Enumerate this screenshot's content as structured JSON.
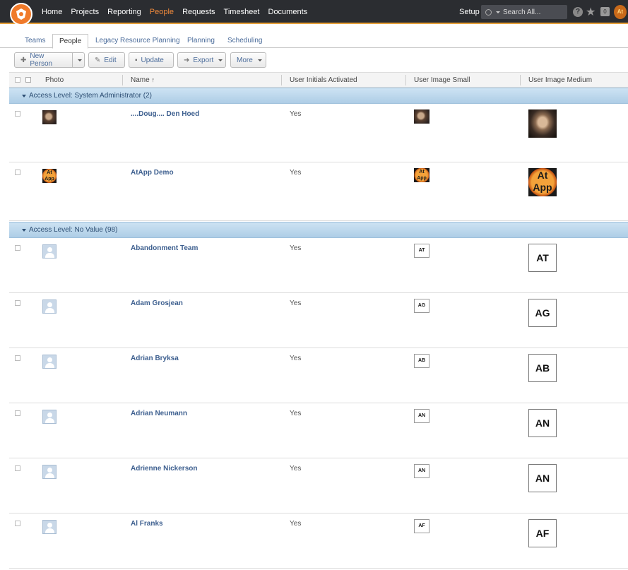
{
  "nav": {
    "items": [
      "Home",
      "Projects",
      "Reporting",
      "People",
      "Requests",
      "Timesheet",
      "Documents"
    ],
    "active": "People",
    "setup": "Setup",
    "search_placeholder": "Search All...",
    "help": "?",
    "notifications": "0",
    "avatar_initials": "At"
  },
  "tabs": [
    "Teams",
    "People",
    "Legacy Resource Planning",
    "Planning",
    "Scheduling"
  ],
  "toolbar": {
    "new_person": "New Person",
    "edit": "Edit",
    "update": "Update",
    "export": "Export",
    "more": "More"
  },
  "columns": {
    "photo": "Photo",
    "name": "Name",
    "initials": "User Initials Activated",
    "small": "User Image Small",
    "medium": "User Image Medium"
  },
  "groups": [
    {
      "label": "Access Level: System Administrator (2)",
      "rows": [
        {
          "name": "....Doug.... Den Hoed",
          "initials_activated": "Yes",
          "image": "photo",
          "initials": ""
        },
        {
          "name": "AtApp Demo",
          "initials_activated": "Yes",
          "image": "atapp-logo",
          "initials": "At App"
        }
      ]
    },
    {
      "label": "Access Level: No Value (98)",
      "rows": [
        {
          "name": "Abandonment Team",
          "initials_activated": "Yes",
          "image": "initials",
          "initials": "AT"
        },
        {
          "name": "Adam Grosjean",
          "initials_activated": "Yes",
          "image": "initials",
          "initials": "AG"
        },
        {
          "name": "Adrian Bryksa",
          "initials_activated": "Yes",
          "image": "initials",
          "initials": "AB"
        },
        {
          "name": "Adrian Neumann",
          "initials_activated": "Yes",
          "image": "initials",
          "initials": "AN"
        },
        {
          "name": "Adrienne Nickerson",
          "initials_activated": "Yes",
          "image": "initials",
          "initials": "AN"
        },
        {
          "name": "Al Franks",
          "initials_activated": "Yes",
          "image": "initials",
          "initials": "AF"
        }
      ]
    }
  ],
  "colors": {
    "topbar": "#2b2d31",
    "accent": "#f08a3c",
    "link": "#3d5f8f",
    "group_band": "#bcd7ec"
  }
}
